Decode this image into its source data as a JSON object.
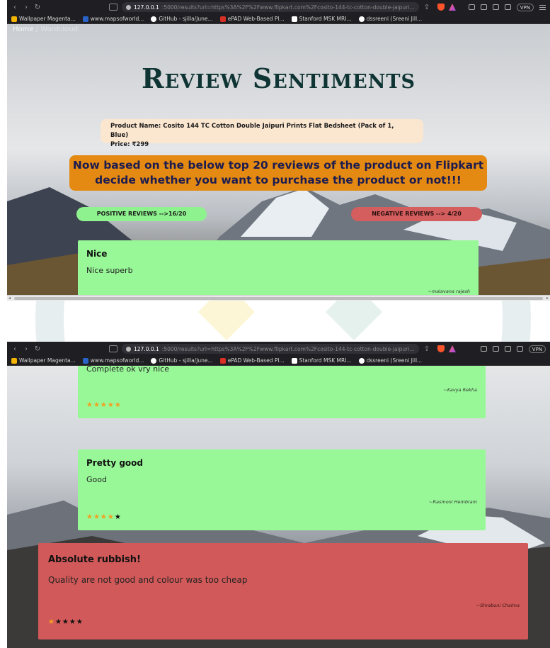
{
  "browser": {
    "url_host": "127.0.0.1",
    "url_path_1": ":5000/results?url=https%3A%2F%2Fwww.flipkart.com%2Fcosito-144-tc-cotton-double-jaipuri...",
    "url_path_2": ":5000/results?url=https%3A%2F%2Fwww.flipkart.com%2Fcosito-144-tc-cotton-double-jaipuri...",
    "vpn_label": "VPN",
    "bookmarks": [
      {
        "label": "Wallpaper Magenta...",
        "color": "#f5b400"
      },
      {
        "label": "www.mapsofworld...",
        "color": "#2a63c7"
      },
      {
        "label": "GitHub - sjilla/June...",
        "color": "#ffffff"
      },
      {
        "label": "ePAD Web-Based Pl...",
        "color": "#d93025"
      },
      {
        "label": "Stanford MSK MRI...",
        "color": "#ffffff"
      },
      {
        "label": "dssreeni (Sreeni Jill...",
        "color": "#ffffff"
      }
    ]
  },
  "breadcrumb": {
    "home": "Home",
    "sep": " / ",
    "current": "Wordcloud"
  },
  "page": {
    "title": "Review Sentiments",
    "product_line": "Product Name: Cosito 144 TC Cotton Double Jaipuri Prints Flat Bedsheet  (Pack of 1, Blue)",
    "price_line": "Price: ₹299",
    "banner": "Now based on the below top 20 reviews of the product on Flipkart decide whether you want to purchase the product or not!!!",
    "positive_label": "POSITIVE REVIEWS -->16/20",
    "negative_label": "NEGATIVE REVIEWS --> 4/20"
  },
  "reviews": [
    {
      "title": "Nice",
      "text": "Nice superb",
      "author": "~malavana rajesh",
      "rating": 5,
      "sentiment": "positive"
    },
    {
      "title": "",
      "text": "Complete ok vry nice",
      "author": "~Kavya Rekha",
      "rating": 5,
      "sentiment": "positive"
    },
    {
      "title": "Pretty good",
      "text": "Good",
      "author": "~Rasmoni Hembram",
      "rating": 4,
      "sentiment": "positive"
    },
    {
      "title": "Absolute rubbish!",
      "text": "Quality are not good and colour was too cheap",
      "author": "~Shraboni Chalma",
      "rating": 1,
      "sentiment": "negative"
    }
  ],
  "colors": {
    "positive": "#98f898",
    "negative": "#d15959",
    "banner": "#e48a12",
    "title": "#0f3434",
    "product_box": "#fbe6d0",
    "star": "#f0a020"
  }
}
